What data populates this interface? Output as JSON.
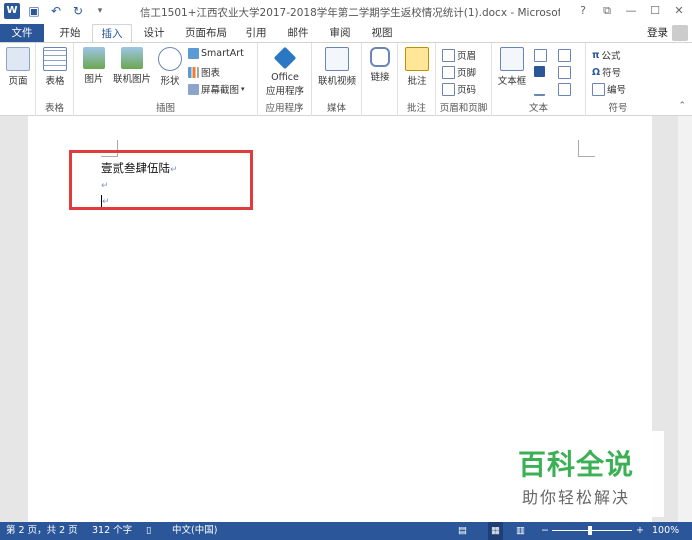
{
  "window": {
    "title": "信工1501+江西农业大学2017-2018学年第二学期学生返校情况统计(1).docx - Microsoft Word",
    "controls": [
      "?",
      "⧉",
      "—",
      "☐",
      "✕"
    ]
  },
  "tabs": {
    "file": "文件",
    "items": [
      "开始",
      "插入",
      "设计",
      "页面布局",
      "引用",
      "邮件",
      "审阅",
      "视图"
    ],
    "active": "插入",
    "login": "登录"
  },
  "ribbon": {
    "pages": {
      "label": "页面",
      "group": ""
    },
    "table": {
      "label": "表格",
      "group": "表格"
    },
    "illustrations": {
      "group": "插图",
      "picture": "图片",
      "online_picture": "联机图片",
      "shapes": "形状",
      "smartart": "SmartArt",
      "chart": "图表",
      "screenshot": "屏幕截图"
    },
    "apps": {
      "label_line1": "Office",
      "label_line2": "应用程序",
      "group": "应用程序"
    },
    "media": {
      "label": "联机视频",
      "group": "媒体"
    },
    "links": {
      "label": "链接",
      "group": ""
    },
    "comments": {
      "label": "批注",
      "group": "批注"
    },
    "header_footer": {
      "group": "页眉和页脚",
      "header": "页眉",
      "footer": "页脚",
      "page_number": "页码"
    },
    "text": {
      "group": "文本",
      "textbox": "文本框"
    },
    "symbols": {
      "group": "符号",
      "equation": "公式",
      "symbol": "符号",
      "number": "编号"
    }
  },
  "document": {
    "line1": "壹贰叁肆伍陆",
    "pilcrow": "↵"
  },
  "watermark": {
    "main": "百科全说",
    "sub": "助你轻松解决"
  },
  "status": {
    "page": "第 2 页，共 2 页",
    "words": "312 个字",
    "language": "中文(中国)",
    "zoom": "100%"
  },
  "colors": {
    "accent": "#2b579a",
    "highlight": "#e03c3c",
    "watermark": "#3cb054"
  }
}
